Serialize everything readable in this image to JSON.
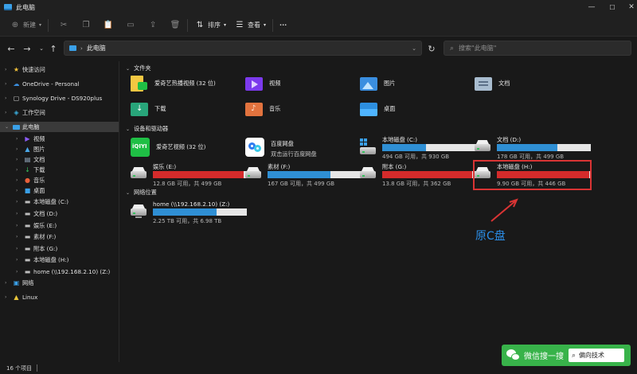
{
  "window": {
    "title": "此电脑",
    "controls": {
      "minimize": "—",
      "maximize": "☐",
      "close": "✕"
    }
  },
  "toolbar": {
    "new_label": "新建",
    "sort_label": "排序",
    "view_label": "查看",
    "more_label": "···"
  },
  "address": {
    "crumb": "此电脑",
    "search_placeholder": "搜索\"此电脑\""
  },
  "sidebar": {
    "items": [
      {
        "label": "快速访问",
        "icon": "star-icon"
      },
      {
        "label": "OneDrive - Personal",
        "icon": "cloud-icon"
      },
      {
        "label": "Synology Drive - DS920plus",
        "icon": "sync-drive-icon"
      },
      {
        "label": "工作空间",
        "icon": "workspace-icon"
      },
      {
        "label": "此电脑",
        "icon": "computer-icon"
      },
      {
        "label": "视频",
        "icon": "video-folder-icon"
      },
      {
        "label": "图片",
        "icon": "picture-folder-icon"
      },
      {
        "label": "文档",
        "icon": "document-folder-icon"
      },
      {
        "label": "下载",
        "icon": "download-icon"
      },
      {
        "label": "音乐",
        "icon": "music-icon"
      },
      {
        "label": "桌面",
        "icon": "desktop-folder-icon"
      },
      {
        "label": "本地磁盘 (C:)",
        "icon": "drive-icon"
      },
      {
        "label": "文档 (D:)",
        "icon": "drive-icon"
      },
      {
        "label": "娱乐 (E:)",
        "icon": "drive-icon"
      },
      {
        "label": "素材 (F:)",
        "icon": "drive-icon"
      },
      {
        "label": "附本 (G:)",
        "icon": "drive-icon"
      },
      {
        "label": "本地磁盘 (H:)",
        "icon": "drive-icon"
      },
      {
        "label": "home (\\\\192.168.2.10) (Z:)",
        "icon": "network-drive-icon"
      },
      {
        "label": "网络",
        "icon": "network-icon"
      },
      {
        "label": "Linux",
        "icon": "linux-icon"
      }
    ]
  },
  "sections": {
    "folders": "文件夹",
    "devices": "设备和驱动器",
    "network": "网络位置"
  },
  "folders": [
    {
      "name": "爱奇艺热播视频 (32 位)",
      "icon": "iqiyi-folder-icon"
    },
    {
      "name": "视频",
      "icon": "video-folder-icon"
    },
    {
      "name": "图片",
      "icon": "picture-folder-icon"
    },
    {
      "name": "文档",
      "icon": "document-folder-icon"
    },
    {
      "name": "下载",
      "icon": "download-folder-icon"
    },
    {
      "name": "音乐",
      "icon": "music-folder-icon"
    },
    {
      "name": "桌面",
      "icon": "desktop-folder-icon"
    }
  ],
  "apps": [
    {
      "name": "爱奇艺视频 (32 位)",
      "icon": "iqiyi-app-icon"
    },
    {
      "name": "百度网盘",
      "sub": "双击运行百度网盘",
      "icon": "baidu-netdisk-icon"
    }
  ],
  "drives": [
    {
      "name": "本地磁盘 (C:)",
      "free": "494 GB 可用，共 930 GB",
      "used_fraction": 0.47,
      "color": "#2f8fd4"
    },
    {
      "name": "文档 (D:)",
      "free": "178 GB 可用，共 499 GB",
      "used_fraction": 0.64,
      "color": "#2f8fd4"
    },
    {
      "name": "娱乐 (E:)",
      "free": "12.8 GB 可用，共 499 GB",
      "used_fraction": 0.97,
      "color": "#d42b2b"
    },
    {
      "name": "素材 (F:)",
      "free": "167 GB 可用，共 499 GB",
      "used_fraction": 0.67,
      "color": "#2f8fd4"
    },
    {
      "name": "附本 (G:)",
      "free": "13.8 GB 可用，共 362 GB",
      "used_fraction": 0.96,
      "color": "#d42b2b"
    },
    {
      "name": "本地磁盘 (H:)",
      "free": "9.90 GB 可用，共 446 GB",
      "used_fraction": 0.98,
      "color": "#d42b2b"
    }
  ],
  "network_drives": [
    {
      "name": "home (\\\\192.168.2.10) (Z:)",
      "free": "2.25 TB 可用，共 6.98 TB",
      "used_fraction": 0.68,
      "color": "#2f8fd4"
    }
  ],
  "annotation": {
    "text": "原C盘",
    "color": "#2b8ee8",
    "box_color": "#d93434"
  },
  "status": {
    "count": "16 个项目"
  },
  "watermark": {
    "text": "微信搜一搜",
    "search_text": "偏向技术"
  }
}
